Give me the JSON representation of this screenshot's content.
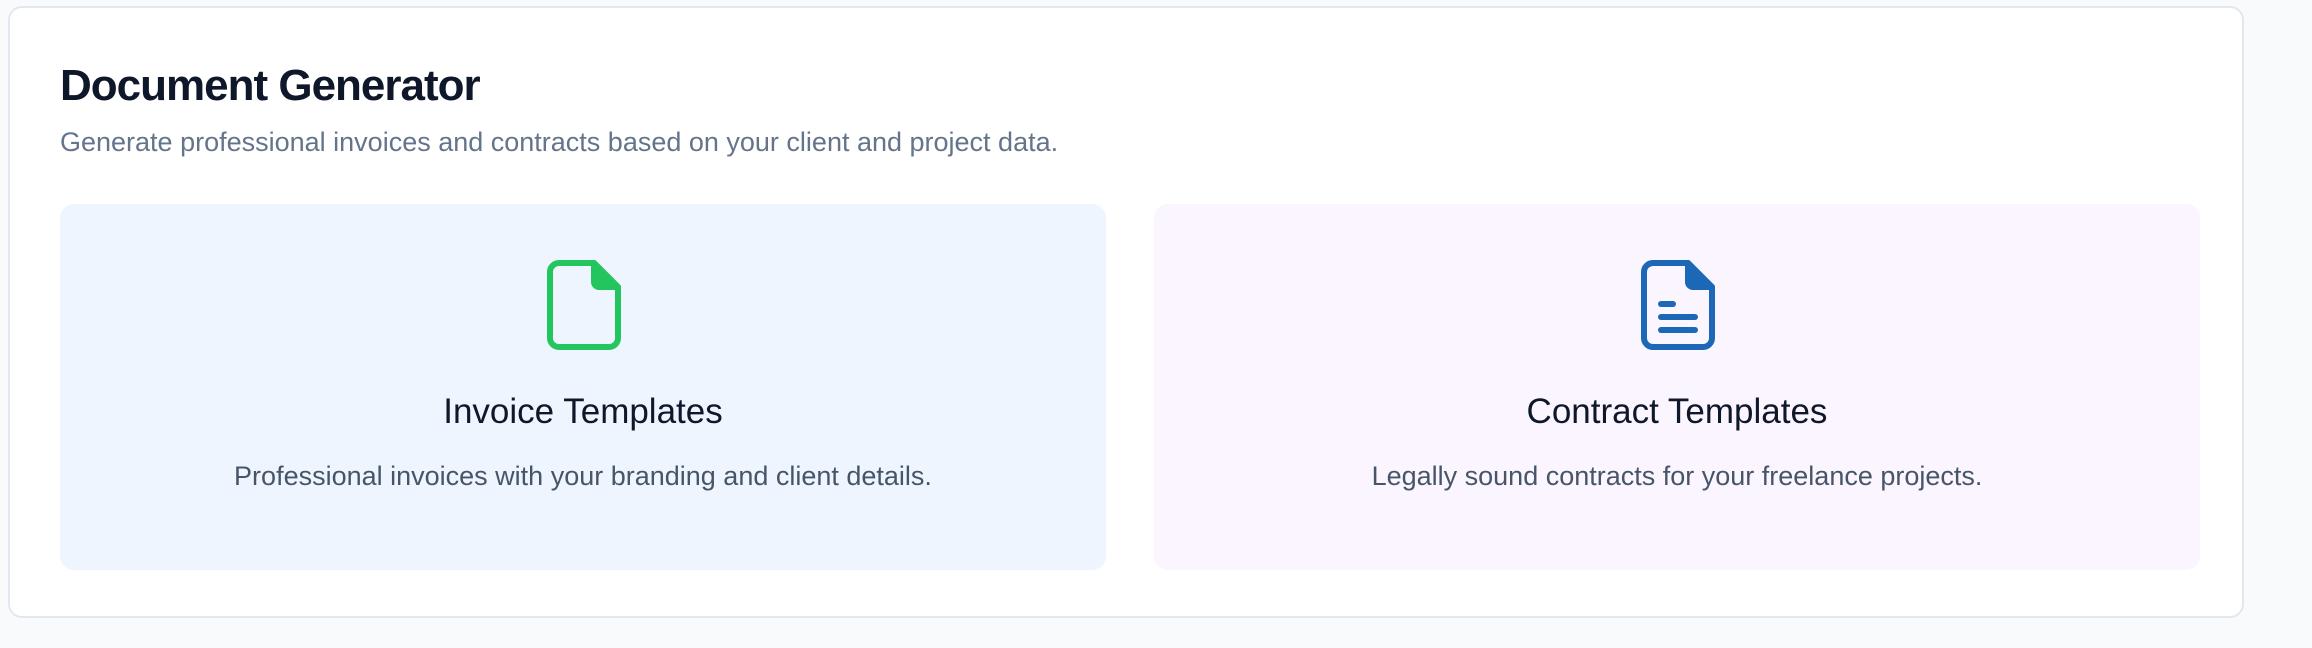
{
  "header": {
    "title": "Document Generator",
    "subtitle": "Generate professional invoices and contracts based on your client and project data."
  },
  "cards": [
    {
      "title": "Invoice Templates",
      "description": "Professional invoices with your branding and client details.",
      "icon": "file-icon",
      "icon_color": "#22c55e",
      "background": "#eff5fe"
    },
    {
      "title": "Contract Templates",
      "description": "Legally sound contracts for your freelance projects.",
      "icon": "file-text-icon",
      "icon_color": "#1d68b6",
      "background": "#faf5fe"
    }
  ]
}
